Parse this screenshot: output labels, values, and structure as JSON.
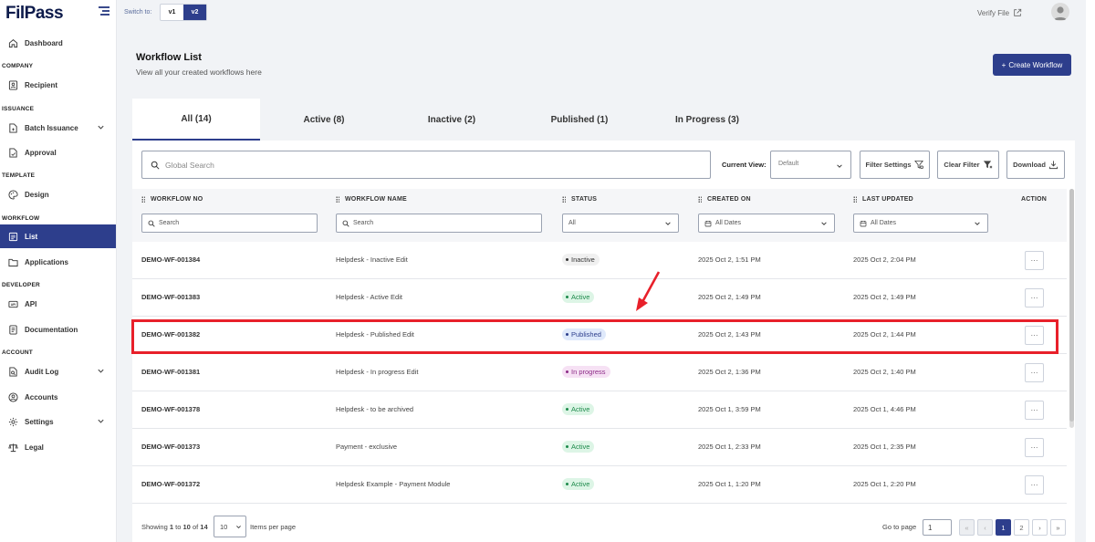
{
  "app": {
    "logo": "FilPass"
  },
  "sidebar": {
    "items": [
      {
        "label": "Dashboard",
        "icon": "home-icon"
      },
      {
        "section": "COMPANY"
      },
      {
        "label": "Recipient",
        "icon": "contact-icon"
      },
      {
        "section": "ISSUANCE"
      },
      {
        "label": "Batch Issuance",
        "icon": "document-add-icon",
        "expandable": true
      },
      {
        "label": "Approval",
        "icon": "document-check-icon"
      },
      {
        "section": "TEMPLATE"
      },
      {
        "label": "Design",
        "icon": "palette-icon"
      },
      {
        "section": "WORKFLOW"
      },
      {
        "label": "List",
        "icon": "list-icon",
        "active": true
      },
      {
        "label": "Applications",
        "icon": "folder-icon"
      },
      {
        "section": "DEVELOPER"
      },
      {
        "label": "API",
        "icon": "api-icon"
      },
      {
        "label": "Documentation",
        "icon": "doc-icon"
      },
      {
        "section": "ACCOUNT"
      },
      {
        "label": "Audit Log",
        "icon": "audit-icon",
        "expandable": true
      },
      {
        "label": "Accounts",
        "icon": "user-circle-icon"
      },
      {
        "label": "Settings",
        "icon": "gear-icon",
        "expandable": true
      },
      {
        "label": "Legal",
        "icon": "scale-icon"
      }
    ]
  },
  "topbar": {
    "switch_label": "Switch to:",
    "versions": [
      "v1",
      "v2"
    ],
    "active_version": "v2",
    "verify_label": "Verify File"
  },
  "page": {
    "title": "Workflow List",
    "subtitle": "View all your created workflows here",
    "create_button": "Create Workflow"
  },
  "tabs": [
    {
      "label": "All (14)",
      "active": true
    },
    {
      "label": "Active (8)"
    },
    {
      "label": "Inactive (2)"
    },
    {
      "label": "Published (1)"
    },
    {
      "label": "In Progress (3)"
    }
  ],
  "toolbar": {
    "search_placeholder": "Global Search",
    "current_view_label": "Current View:",
    "current_view_value": "Default",
    "filter_settings": "Filter Settings",
    "clear_filter": "Clear Filter",
    "download": "Download"
  },
  "table": {
    "columns": [
      "WORKFLOW NO",
      "WORKFLOW NAME",
      "STATUS",
      "CREATED ON",
      "LAST UPDATED",
      "ACTION"
    ],
    "filters": {
      "workflow_no": "Search",
      "workflow_name": "Search",
      "status": "All",
      "created_on": "All Dates",
      "last_updated": "All Dates"
    },
    "action_label": "···",
    "rows": [
      {
        "no": "DEMO-WF-001384",
        "name": "Helpdesk - Inactive Edit",
        "status": "Inactive",
        "created": "2025 Oct 2, 1:51 PM",
        "updated": "2025 Oct 2, 2:04 PM"
      },
      {
        "no": "DEMO-WF-001383",
        "name": "Helpdesk - Active Edit",
        "status": "Active",
        "created": "2025 Oct 2, 1:49 PM",
        "updated": "2025 Oct 2, 1:49 PM"
      },
      {
        "no": "DEMO-WF-001382",
        "name": "Helpdesk - Published Edit",
        "status": "Published",
        "created": "2025 Oct 2, 1:43 PM",
        "updated": "2025 Oct 2, 1:44 PM"
      },
      {
        "no": "DEMO-WF-001381",
        "name": "Helpdesk - In progress Edit",
        "status": "In progress",
        "created": "2025 Oct 2, 1:36 PM",
        "updated": "2025 Oct 2, 1:40 PM"
      },
      {
        "no": "DEMO-WF-001378",
        "name": "Helpdesk - to be archived",
        "status": "Active",
        "created": "2025 Oct 1, 3:59 PM",
        "updated": "2025 Oct 1, 4:46 PM"
      },
      {
        "no": "DEMO-WF-001373",
        "name": "Payment - exclusive",
        "status": "Active",
        "created": "2025 Oct 1, 2:33 PM",
        "updated": "2025 Oct 1, 2:35 PM"
      },
      {
        "no": "DEMO-WF-001372",
        "name": "Helpdesk Example - Payment Module",
        "status": "Active",
        "created": "2025 Oct 1, 1:20 PM",
        "updated": "2025 Oct 1, 2:20 PM"
      }
    ]
  },
  "pagination": {
    "showing_prefix": "Showing",
    "showing_from": "1",
    "showing_to_word": "to",
    "showing_to": "10",
    "showing_of_word": "of",
    "showing_total": "14",
    "per_page": "10",
    "per_page_label": "Items per page",
    "goto_label": "Go to page",
    "goto_value": "1",
    "pages": [
      "1",
      "2"
    ],
    "current_page": "1"
  },
  "colors": {
    "primary": "#2d3e8c",
    "highlight": "#e8202a",
    "active_badge": "#1d8a4b",
    "progress_badge": "#8c2a86"
  }
}
